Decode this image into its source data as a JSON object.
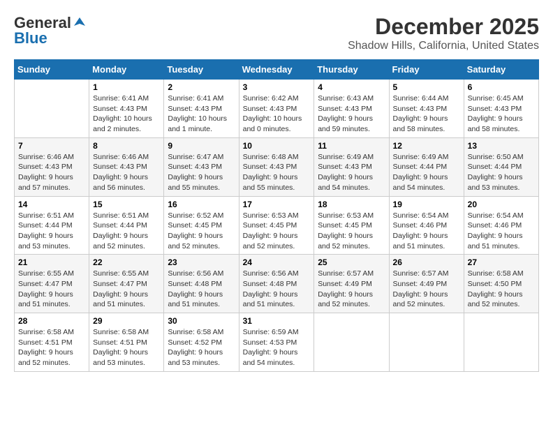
{
  "logo": {
    "line1": "General",
    "line2": "Blue"
  },
  "title": "December 2025",
  "location": "Shadow Hills, California, United States",
  "days_header": [
    "Sunday",
    "Monday",
    "Tuesday",
    "Wednesday",
    "Thursday",
    "Friday",
    "Saturday"
  ],
  "weeks": [
    [
      {
        "day": "",
        "info": ""
      },
      {
        "day": "1",
        "info": "Sunrise: 6:41 AM\nSunset: 4:43 PM\nDaylight: 10 hours\nand 2 minutes."
      },
      {
        "day": "2",
        "info": "Sunrise: 6:41 AM\nSunset: 4:43 PM\nDaylight: 10 hours\nand 1 minute."
      },
      {
        "day": "3",
        "info": "Sunrise: 6:42 AM\nSunset: 4:43 PM\nDaylight: 10 hours\nand 0 minutes."
      },
      {
        "day": "4",
        "info": "Sunrise: 6:43 AM\nSunset: 4:43 PM\nDaylight: 9 hours\nand 59 minutes."
      },
      {
        "day": "5",
        "info": "Sunrise: 6:44 AM\nSunset: 4:43 PM\nDaylight: 9 hours\nand 58 minutes."
      },
      {
        "day": "6",
        "info": "Sunrise: 6:45 AM\nSunset: 4:43 PM\nDaylight: 9 hours\nand 58 minutes."
      }
    ],
    [
      {
        "day": "7",
        "info": "Sunrise: 6:46 AM\nSunset: 4:43 PM\nDaylight: 9 hours\nand 57 minutes."
      },
      {
        "day": "8",
        "info": "Sunrise: 6:46 AM\nSunset: 4:43 PM\nDaylight: 9 hours\nand 56 minutes."
      },
      {
        "day": "9",
        "info": "Sunrise: 6:47 AM\nSunset: 4:43 PM\nDaylight: 9 hours\nand 55 minutes."
      },
      {
        "day": "10",
        "info": "Sunrise: 6:48 AM\nSunset: 4:43 PM\nDaylight: 9 hours\nand 55 minutes."
      },
      {
        "day": "11",
        "info": "Sunrise: 6:49 AM\nSunset: 4:43 PM\nDaylight: 9 hours\nand 54 minutes."
      },
      {
        "day": "12",
        "info": "Sunrise: 6:49 AM\nSunset: 4:44 PM\nDaylight: 9 hours\nand 54 minutes."
      },
      {
        "day": "13",
        "info": "Sunrise: 6:50 AM\nSunset: 4:44 PM\nDaylight: 9 hours\nand 53 minutes."
      }
    ],
    [
      {
        "day": "14",
        "info": "Sunrise: 6:51 AM\nSunset: 4:44 PM\nDaylight: 9 hours\nand 53 minutes."
      },
      {
        "day": "15",
        "info": "Sunrise: 6:51 AM\nSunset: 4:44 PM\nDaylight: 9 hours\nand 52 minutes."
      },
      {
        "day": "16",
        "info": "Sunrise: 6:52 AM\nSunset: 4:45 PM\nDaylight: 9 hours\nand 52 minutes."
      },
      {
        "day": "17",
        "info": "Sunrise: 6:53 AM\nSunset: 4:45 PM\nDaylight: 9 hours\nand 52 minutes."
      },
      {
        "day": "18",
        "info": "Sunrise: 6:53 AM\nSunset: 4:45 PM\nDaylight: 9 hours\nand 52 minutes."
      },
      {
        "day": "19",
        "info": "Sunrise: 6:54 AM\nSunset: 4:46 PM\nDaylight: 9 hours\nand 51 minutes."
      },
      {
        "day": "20",
        "info": "Sunrise: 6:54 AM\nSunset: 4:46 PM\nDaylight: 9 hours\nand 51 minutes."
      }
    ],
    [
      {
        "day": "21",
        "info": "Sunrise: 6:55 AM\nSunset: 4:47 PM\nDaylight: 9 hours\nand 51 minutes."
      },
      {
        "day": "22",
        "info": "Sunrise: 6:55 AM\nSunset: 4:47 PM\nDaylight: 9 hours\nand 51 minutes."
      },
      {
        "day": "23",
        "info": "Sunrise: 6:56 AM\nSunset: 4:48 PM\nDaylight: 9 hours\nand 51 minutes."
      },
      {
        "day": "24",
        "info": "Sunrise: 6:56 AM\nSunset: 4:48 PM\nDaylight: 9 hours\nand 51 minutes."
      },
      {
        "day": "25",
        "info": "Sunrise: 6:57 AM\nSunset: 4:49 PM\nDaylight: 9 hours\nand 52 minutes."
      },
      {
        "day": "26",
        "info": "Sunrise: 6:57 AM\nSunset: 4:49 PM\nDaylight: 9 hours\nand 52 minutes."
      },
      {
        "day": "27",
        "info": "Sunrise: 6:58 AM\nSunset: 4:50 PM\nDaylight: 9 hours\nand 52 minutes."
      }
    ],
    [
      {
        "day": "28",
        "info": "Sunrise: 6:58 AM\nSunset: 4:51 PM\nDaylight: 9 hours\nand 52 minutes."
      },
      {
        "day": "29",
        "info": "Sunrise: 6:58 AM\nSunset: 4:51 PM\nDaylight: 9 hours\nand 53 minutes."
      },
      {
        "day": "30",
        "info": "Sunrise: 6:58 AM\nSunset: 4:52 PM\nDaylight: 9 hours\nand 53 minutes."
      },
      {
        "day": "31",
        "info": "Sunrise: 6:59 AM\nSunset: 4:53 PM\nDaylight: 9 hours\nand 54 minutes."
      },
      {
        "day": "",
        "info": ""
      },
      {
        "day": "",
        "info": ""
      },
      {
        "day": "",
        "info": ""
      }
    ]
  ]
}
